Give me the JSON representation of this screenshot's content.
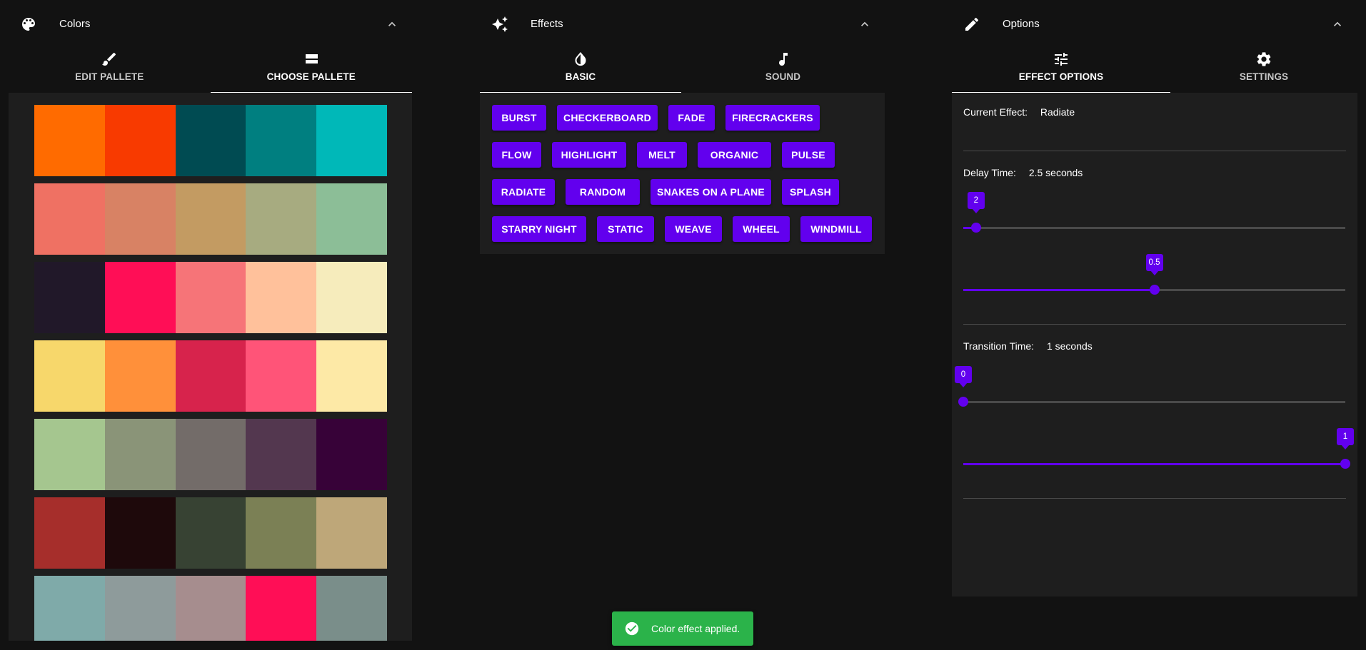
{
  "colors": {
    "title": "Colors",
    "icon": "palette-icon",
    "tabs": [
      {
        "label": "EDIT PALLETE",
        "icon": "brush-icon",
        "active": false
      },
      {
        "label": "CHOOSE PALLETE",
        "icon": "view-stream-icon",
        "active": true
      }
    ],
    "palettes": [
      [
        "#ff6b00",
        "#f83a00",
        "#004b52",
        "#007f80",
        "#00b8b8"
      ],
      [
        "#ef7163",
        "#d88264",
        "#c39b62",
        "#a7ab80",
        "#8cbe97"
      ],
      [
        "#211829",
        "#ff0e56",
        "#f67478",
        "#ffc19b",
        "#f6ecbc"
      ],
      [
        "#f7d76b",
        "#ff903a",
        "#d7234c",
        "#ff5478",
        "#fde9a6"
      ],
      [
        "#a5c68f",
        "#8a9478",
        "#736c69",
        "#53374f",
        "#370238"
      ],
      [
        "#a62e2b",
        "#1e090b",
        "#374233",
        "#7b8055",
        "#bea779"
      ],
      [
        "#7faaa9",
        "#8e9b9b",
        "#a68d8e",
        "#ff0e56",
        "#7a8e8a"
      ]
    ]
  },
  "effects": {
    "title": "Effects",
    "icon": "sparkles-icon",
    "tabs": [
      {
        "label": "BASIC",
        "icon": "contrast-drop-icon",
        "active": true
      },
      {
        "label": "SOUND",
        "icon": "music-note-icon",
        "active": false
      }
    ],
    "buttons": [
      "BURST",
      "CHECKERBOARD",
      "FADE",
      "FIRECRACKERS",
      "FLOW",
      "HIGHLIGHT",
      "MELT",
      "ORGANIC",
      "PULSE",
      "RADIATE",
      "RANDOM",
      "SNAKES ON A PLANE",
      "SPLASH",
      "STARRY NIGHT",
      "STATIC",
      "WEAVE",
      "WHEEL",
      "WINDMILL"
    ]
  },
  "options": {
    "title": "Options",
    "icon": "pencil-icon",
    "tabs": [
      {
        "label": "EFFECT OPTIONS",
        "icon": "tune-icon",
        "active": true
      },
      {
        "label": "SETTINGS",
        "icon": "gear-icon",
        "active": false
      }
    ],
    "current_effect": {
      "label": "Current Effect:",
      "value": "Radiate"
    },
    "delay_time": {
      "label": "Delay Time:",
      "value": "2.5 seconds"
    },
    "transition_time": {
      "label": "Transition Time:",
      "value": "1 seconds"
    },
    "sliders": [
      {
        "name": "delay-seconds-slider",
        "value": 2,
        "label": "2",
        "min": 0,
        "max": 60
      },
      {
        "name": "delay-fraction-slider",
        "value": 0.5,
        "label": "0.5",
        "min": 0,
        "max": 1
      },
      {
        "name": "transition-seconds-slider",
        "value": 0,
        "label": "0",
        "min": 0,
        "max": 60
      },
      {
        "name": "transition-fraction-slider",
        "value": 1,
        "label": "1",
        "min": 0,
        "max": 1
      }
    ]
  },
  "toast": {
    "message": "Color effect applied.",
    "icon": "check-circle-icon",
    "color": "#2bb34a"
  },
  "theme": {
    "accent": "#6200ee",
    "background": "#121212",
    "surface": "#1e1e1e"
  }
}
